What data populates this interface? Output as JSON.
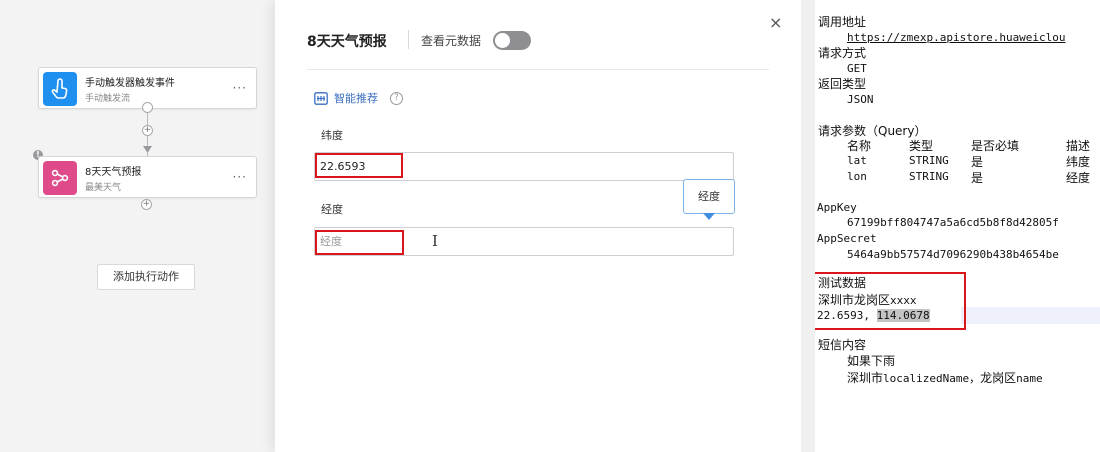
{
  "canvas": {
    "trigger_node": {
      "title": "手动触发器触发事件",
      "subtitle": "手动触发流",
      "more": "···"
    },
    "weather_node": {
      "title": "8天天气预报",
      "subtitle": "最美天气",
      "more": "···"
    },
    "add_button": "添加执行动作",
    "warning": "!"
  },
  "panel": {
    "title": "8天天气预报",
    "meta_label": "查看元数据",
    "close": "×",
    "smart_recommend": "智能推荐",
    "help": "?",
    "lat_label": "纬度",
    "lat_value": "22.6593",
    "lon_label": "经度",
    "lon_placeholder": "经度",
    "tooltip": "经度"
  },
  "notes": {
    "call_address_label": "调用地址",
    "call_address_url": "https://zmexp.apistore.huaweiclou",
    "method_label": "请求方式",
    "method_value": "GET",
    "return_type_label": "返回类型",
    "return_type_value": "JSON",
    "params_label": "请求参数（Query）",
    "params_headers": [
      "名称",
      "类型",
      "是否必填",
      "描述"
    ],
    "params_rows": [
      [
        "lat",
        "STRING",
        "是",
        "纬度"
      ],
      [
        "lon",
        "STRING",
        "是",
        "经度"
      ]
    ],
    "appkey_label": "AppKey",
    "appkey_value": "67199bff804747a5a6cd5b8f8d42805f",
    "appsecret_label": "AppSecret",
    "appsecret_value": "5464a9bb57574d7096290b438b4654be",
    "test_label": "测试数据",
    "test_location_prefix": "深圳市龙岗区",
    "test_location_suffix": "xxxx",
    "test_coords_lat": "22.6593, ",
    "test_coords_lon": "114.0678",
    "sms_label": "短信内容",
    "sms_line1": "如果下雨",
    "sms_line2_cn1": "深圳市",
    "sms_line2_code1": "localizedName，",
    "sms_line2_cn2": "龙岗区",
    "sms_line2_code2": "name"
  }
}
